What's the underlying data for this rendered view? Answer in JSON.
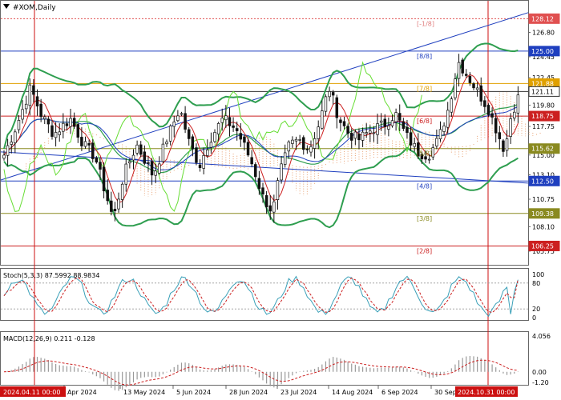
{
  "chart_data": [
    {
      "type": "candlestick",
      "title": "#XOM,Daily",
      "ylim": [
        104.9,
        129.3
      ],
      "x_ticks": [
        "Apr 2024",
        "13 May 2024",
        "5 Jun 2024",
        "28 Jun 2024",
        "23 Jul 2024",
        "14 Aug 2024",
        "6 Sep 2024",
        "30 Sep 2024"
      ],
      "x_markers": [
        "2024.04.11 00:00",
        "2024.10.31 00:00"
      ],
      "y_ticks": [
        105.75,
        108.1,
        110.75,
        113.1,
        115.0,
        117.75,
        119.8,
        122.45,
        124.45,
        126.8
      ],
      "price_levels": [
        {
          "label": "128.12",
          "value": 128.12,
          "color": "#e05050"
        },
        {
          "label": "125.00",
          "value": 125.0,
          "color": "#1f3fbf"
        },
        {
          "label": "121.88",
          "value": 121.88,
          "color": "#e0a000"
        },
        {
          "label": "121.11",
          "value": 121.11,
          "color": "#333333"
        },
        {
          "label": "118.75",
          "value": 118.75,
          "color": "#cc2020"
        },
        {
          "label": "115.62",
          "value": 115.62,
          "color": "#8a8a20"
        },
        {
          "label": "112.50",
          "value": 112.5,
          "color": "#1f3fbf"
        },
        {
          "label": "109.38",
          "value": 109.38,
          "color": "#8a8a20"
        },
        {
          "label": "106.25",
          "value": 106.25,
          "color": "#cc2020"
        }
      ],
      "murrey_labels": [
        {
          "label": "[-1/8]",
          "value": 128.12
        },
        {
          "label": "[8/8]",
          "value": 125.0
        },
        {
          "label": "[7/8]",
          "value": 121.88
        },
        {
          "label": "[6/8]",
          "value": 118.75
        },
        {
          "label": "[5/8]",
          "value": 115.62
        },
        {
          "label": "[4/8]",
          "value": 112.5
        },
        {
          "label": "[3/8]",
          "value": 109.38
        },
        {
          "label": "[2/8]",
          "value": 106.25
        }
      ],
      "colors": {
        "bull": "#ffffff",
        "bear": "#111111",
        "bollinger": "#2e9e4f",
        "ma_fast": "#cc2020",
        "ma_slow": "#1f3fbf",
        "chikou": "#66dd33",
        "cloud": "#e8a070"
      }
    },
    {
      "type": "line",
      "title": "Stoch(5,3,3) 87.5992 88.9834",
      "ylim": [
        0,
        100
      ],
      "y_ticks": [
        100,
        80,
        20,
        0
      ],
      "levels": [
        80,
        20
      ],
      "colors": {
        "main": "#3aa0b8",
        "signal": "#cc2020"
      }
    },
    {
      "type": "bar",
      "title": "MACD(12,26,9) 0.211 -0.128",
      "ylim": [
        -1.2,
        4.056
      ],
      "y_ticks": [
        4.056,
        0.0,
        -1.2
      ],
      "y_tick_labels": [
        "4.056",
        "0.00",
        "-1.20"
      ],
      "colors": {
        "histogram": "#999999",
        "signal": "#cc2020"
      }
    }
  ]
}
